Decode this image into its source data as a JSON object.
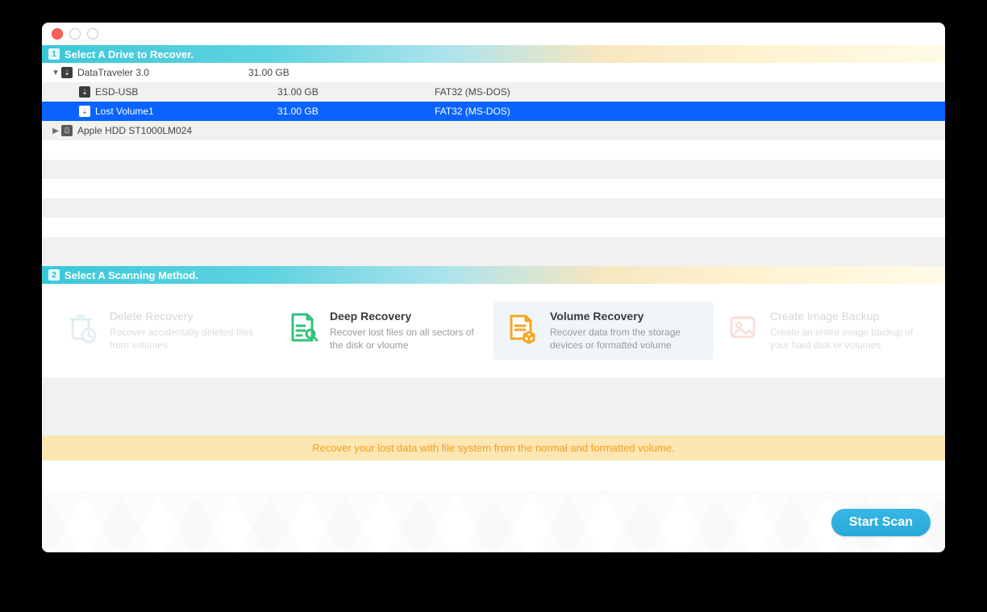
{
  "step1": {
    "num": "1",
    "title": "Select A Drive to Recover."
  },
  "step2": {
    "num": "2",
    "title": "Select A Scanning Method."
  },
  "drives": {
    "d0": {
      "name": "DataTraveler 3.0",
      "size": "31.00 GB",
      "fs": ""
    },
    "d0a": {
      "name": "ESD-USB",
      "size": "31.00 GB",
      "fs": "FAT32 (MS-DOS)"
    },
    "d0b": {
      "name": "Lost Volume1",
      "size": "31.00 GB",
      "fs": "FAT32 (MS-DOS)"
    },
    "d1": {
      "name": "Apple HDD ST1000LM024",
      "size": "",
      "fs": ""
    }
  },
  "methods": {
    "m1": {
      "title": "Delete Recovery",
      "desc": "Recover accidentally deleted files from volumes"
    },
    "m2": {
      "title": "Deep Recovery",
      "desc": "Recover lost files on all sectors of the disk or vloume"
    },
    "m3": {
      "title": "Volume Recovery",
      "desc": "Recover data from the storage devices or formatted volume"
    },
    "m4": {
      "title": "Create Image Backup",
      "desc": "Create an entire image backup of your hard disk or volumes"
    }
  },
  "hint": "Recover your lost data with file system from the normal and formatted volume.",
  "startScan": "Start Scan"
}
